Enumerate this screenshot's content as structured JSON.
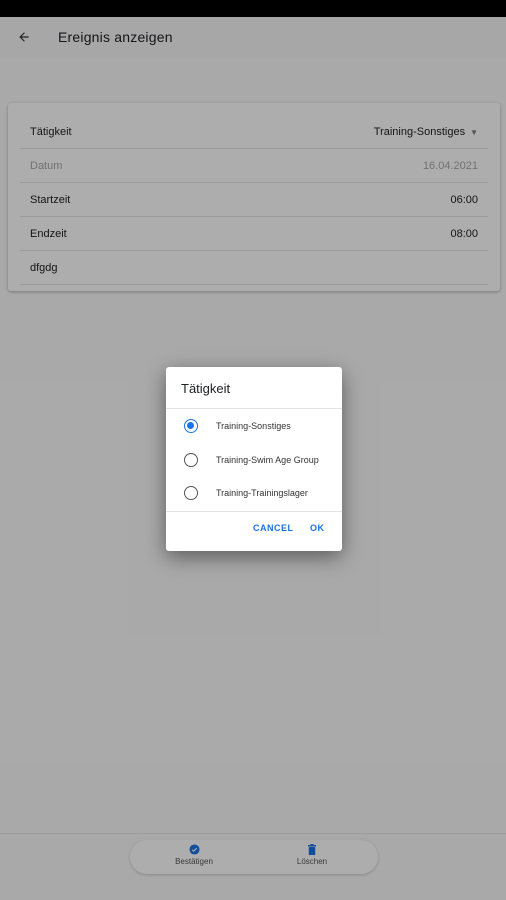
{
  "app_bar": {
    "title": "Ereignis anzeigen",
    "back_icon": "arrow-left-icon"
  },
  "form": {
    "taetigkeit": {
      "label": "Tätigkeit",
      "value": "Training-Sonstiges",
      "icon": "dropdown-caret-icon"
    },
    "datum": {
      "label": "Datum",
      "value": "16.04.2021"
    },
    "startzeit": {
      "label": "Startzeit",
      "value": "06:00"
    },
    "endzeit": {
      "label": "Endzeit",
      "value": "08:00"
    },
    "notiz": {
      "value": "dfgdg"
    }
  },
  "bottom_nav": {
    "confirm": {
      "label": "Bestätigen",
      "icon": "check-circle-icon"
    },
    "delete": {
      "label": "Löschen",
      "icon": "trash-icon"
    }
  },
  "dialog": {
    "title": "Tätigkeit",
    "options": [
      {
        "label": "Training-Sonstiges",
        "selected": true
      },
      {
        "label": "Training-Swim Age Group",
        "selected": false
      },
      {
        "label": "Training-Trainingslager",
        "selected": false
      }
    ],
    "cancel_label": "CANCEL",
    "ok_label": "OK"
  },
  "colors": {
    "accent": "#1a73e8",
    "scrim": "rgba(0,0,0,0.32)"
  }
}
